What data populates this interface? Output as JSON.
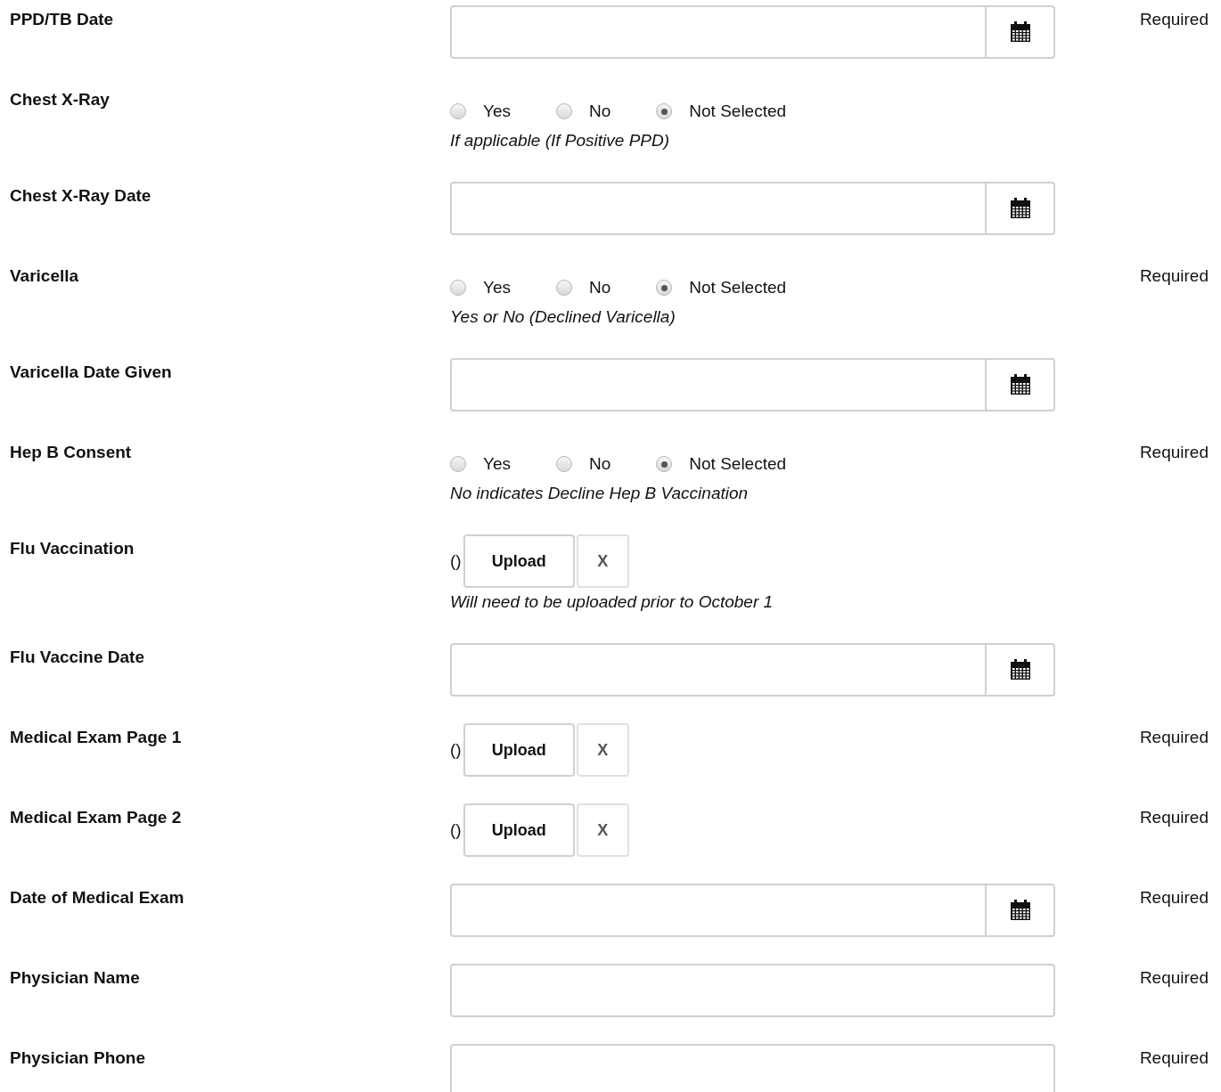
{
  "rows": [
    {
      "label": "PPD/TB Date",
      "kind": "date",
      "note": "Required"
    },
    {
      "label": "Chest X-Ray",
      "kind": "radio",
      "options": [
        {
          "label": "Yes",
          "selected": false
        },
        {
          "label": "No",
          "selected": false
        },
        {
          "label": "Not Selected",
          "selected": true
        }
      ],
      "hint": "If applicable (If Positive PPD)"
    },
    {
      "label": "Chest X-Ray Date",
      "kind": "date"
    },
    {
      "label": "Varicella",
      "kind": "radio",
      "options": [
        {
          "label": "Yes",
          "selected": false
        },
        {
          "label": "No",
          "selected": false
        },
        {
          "label": "Not Selected",
          "selected": true
        }
      ],
      "hint": "Yes or No (Declined Varicella)",
      "note": "Required"
    },
    {
      "label": "Varicella Date Given",
      "kind": "date"
    },
    {
      "label": "Hep B Consent",
      "kind": "radio",
      "options": [
        {
          "label": "Yes",
          "selected": false
        },
        {
          "label": "No",
          "selected": false
        },
        {
          "label": "Not Selected",
          "selected": true
        }
      ],
      "hint": "No indicates Decline Hep B Vaccination",
      "note": "Required"
    },
    {
      "label": "Flu Vaccination",
      "kind": "upload",
      "file": "()",
      "upload": "Upload",
      "clear": "X",
      "hint": "Will need to be uploaded prior to October 1"
    },
    {
      "label": "Flu Vaccine Date",
      "kind": "date"
    },
    {
      "label": "Medical Exam Page 1",
      "kind": "upload",
      "file": "()",
      "upload": "Upload",
      "clear": "X",
      "note": "Required"
    },
    {
      "label": "Medical Exam Page 2",
      "kind": "upload",
      "file": "()",
      "upload": "Upload",
      "clear": "X",
      "note": "Required"
    },
    {
      "label": "Date of Medical Exam",
      "kind": "date",
      "note": "Required"
    },
    {
      "label": "Physician Name",
      "kind": "text",
      "note": "Required"
    },
    {
      "label": "Physician Phone",
      "kind": "text",
      "note": "Required"
    }
  ]
}
